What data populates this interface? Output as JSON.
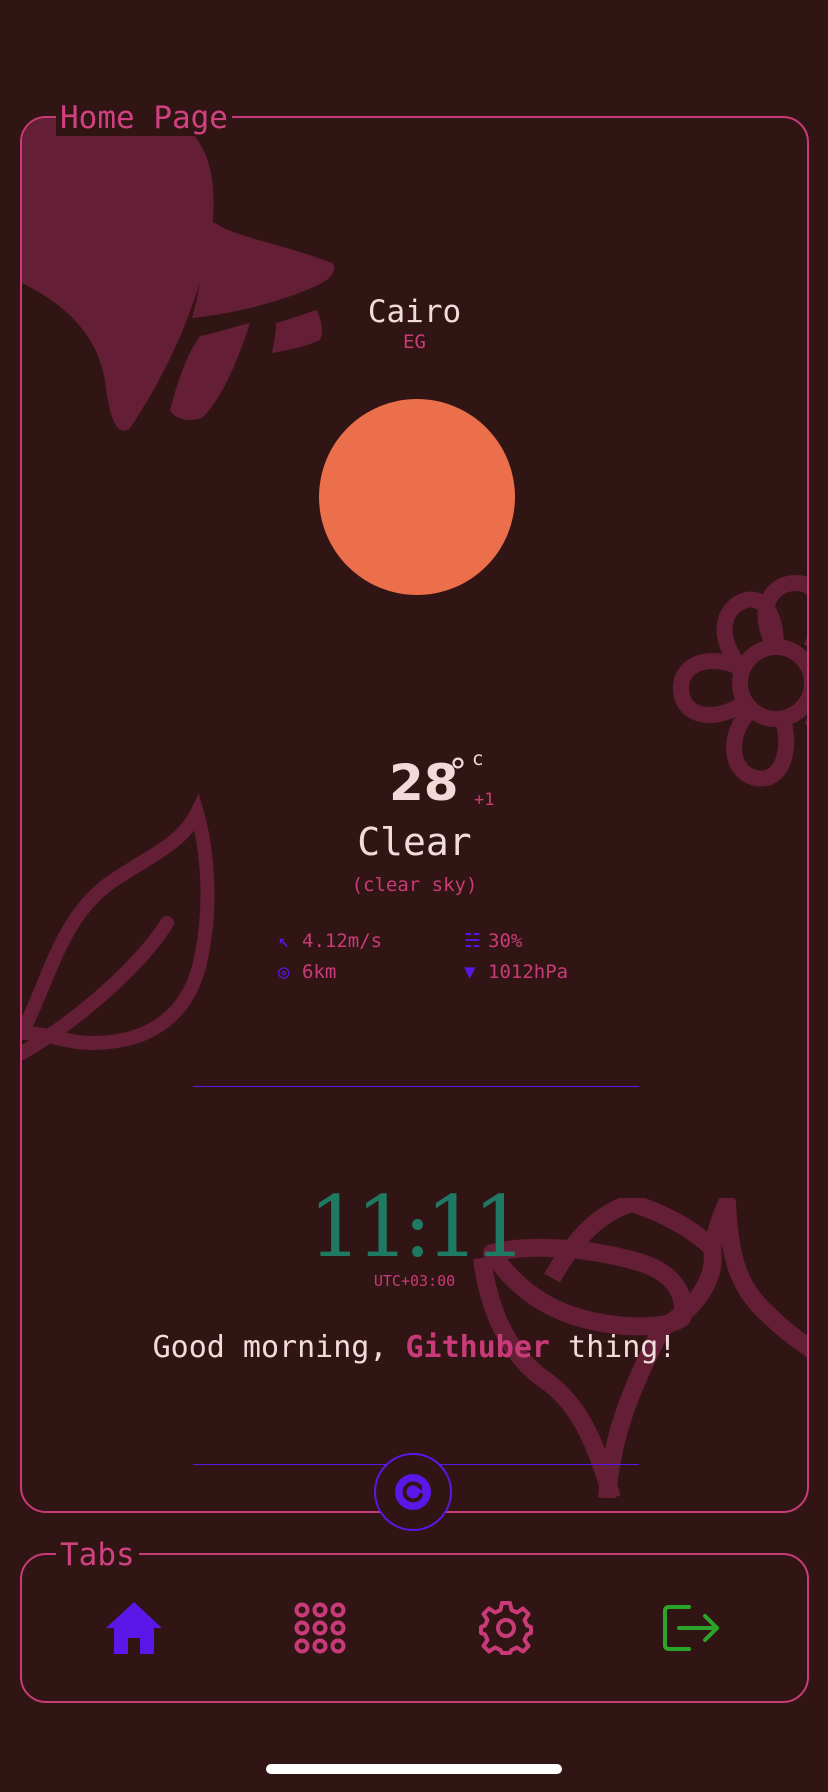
{
  "home_frame": {
    "legend": "Home Page"
  },
  "location": {
    "city": "Cairo",
    "country": "EG"
  },
  "weather": {
    "icon": "sun-icon",
    "temperature": "28",
    "degree_symbol": "°",
    "unit": "c",
    "feels_like_delta": "+1",
    "condition": "Clear",
    "condition_description": "(clear sky)",
    "stats": {
      "wind": {
        "icon": "wind-direction-icon",
        "value": "4.12m/s"
      },
      "humidity": {
        "icon": "humidity-icon",
        "value": "30%"
      },
      "visibility": {
        "icon": "visibility-icon",
        "value": "6km"
      },
      "pressure": {
        "icon": "pressure-icon",
        "value": "1012hPa"
      }
    }
  },
  "clock": {
    "time": "11:11",
    "timezone": "UTC+03:00"
  },
  "greeting": {
    "prefix": "Good morning, ",
    "name": "Githuber",
    "suffix": " thing!"
  },
  "refresh": {
    "icon": "refresh-icon"
  },
  "tabs_frame": {
    "legend": "Tabs",
    "items": [
      {
        "name": "home",
        "icon": "home-icon",
        "active": true
      },
      {
        "name": "apps",
        "icon": "grid-icon",
        "active": false
      },
      {
        "name": "settings",
        "icon": "gear-icon",
        "active": false
      },
      {
        "name": "logout",
        "icon": "logout-icon",
        "active": false
      }
    ]
  },
  "colors": {
    "background": "#311514",
    "accent_pink": "#c93b78",
    "accent_purple": "#5b17e8",
    "sun": "#ec6f4c",
    "clock_green": "#1f7a64",
    "logout_green": "#2aa52a",
    "decoration": "#641e35"
  }
}
